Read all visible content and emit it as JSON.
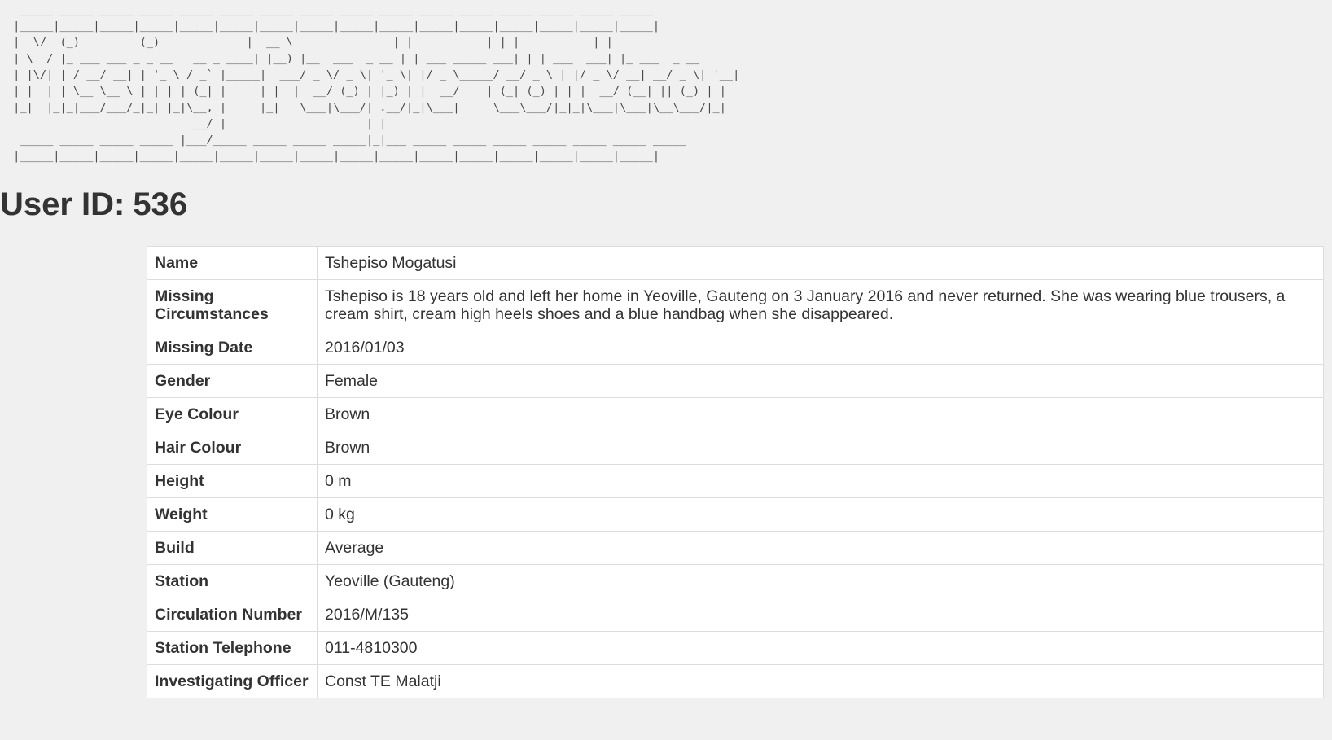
{
  "banner": {
    "art": "  _____ _____ _____ _____ _____ _____ _____ _____ _____ _____ _____ _____ _____ _____ _____ _____\n |_____|_____|_____|_____|_____|_____|_____|_____|_____|_____|_____|_____|_____|_____|_____|_____|\n |  \\/  (_)         (_)             |  __ \\               | |           | | |           | |\n | \\  / |_ ___ ___ _ _ __   __ _ ____| |__) |__  ___  _ __ | | ___ _____ ___| | | ___  ___| |_ ___  _ __\n | |\\/| | / __/ __| | '_ \\ / _` |_____|  ___/ _ \\/ _ \\| '_ \\| |/ _ \\_____/ __/ _ \\ | |/ _ \\/ __| __/ _ \\| '__|\n | |  | | \\__ \\__ \\ | | | | (_| |     | |  |  __/ (_) | |_) | |  __/    | (_| (_) | | |  __/ (__| || (_) | |\n |_|  |_|_|___/___/_|_| |_|\\__, |     |_|   \\___|\\___/| .__/|_|\\___|     \\___\\___/|_|_|\\___|\\___|\\__\\___/|_|\n                            __/ |                     | |\n  _____ _____ _____ _____ |___/_____ _____ _____ _____|_|___ _____ _____ _____ _____ _____ _____ _____\n |_____|_____|_____|_____|_____|_____|_____|_____|_____|_____|_____|_____|_____|_____|_____|_____|"
  },
  "header": {
    "label": "User ID:",
    "user_id": "536"
  },
  "details": {
    "rows": [
      {
        "key": "Name",
        "value": "Tshepiso Mogatusi"
      },
      {
        "key": "Missing Circumstances",
        "value": "Tshepiso is 18 years old and left her home in Yeoville, Gauteng on 3 January 2016 and never returned. She was wearing blue trousers, a cream shirt, cream high heels shoes and a blue handbag when she disappeared."
      },
      {
        "key": "Missing Date",
        "value": "2016/01/03"
      },
      {
        "key": "Gender",
        "value": "Female"
      },
      {
        "key": "Eye Colour",
        "value": "Brown"
      },
      {
        "key": "Hair Colour",
        "value": "Brown"
      },
      {
        "key": "Height",
        "value": "0 m"
      },
      {
        "key": "Weight",
        "value": "0 kg"
      },
      {
        "key": "Build",
        "value": "Average"
      },
      {
        "key": "Station",
        "value": "Yeoville (Gauteng)"
      },
      {
        "key": "Circulation Number",
        "value": "2016/M/135"
      },
      {
        "key": "Station Telephone",
        "value": "011-4810300"
      },
      {
        "key": "Investigating Officer",
        "value": "Const TE Malatji"
      }
    ]
  }
}
